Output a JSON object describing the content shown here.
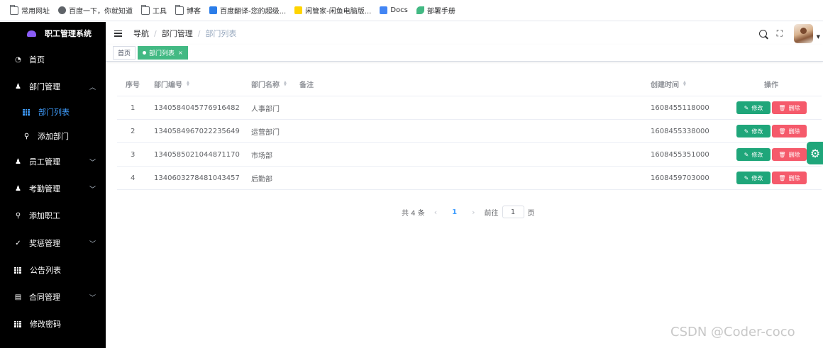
{
  "bookmarks": [
    {
      "label": "常用网址",
      "icon": "folder-icon"
    },
    {
      "label": "百度一下，你就知道",
      "icon": "globe-icon"
    },
    {
      "label": "工具",
      "icon": "folder-icon"
    },
    {
      "label": "博客",
      "icon": "folder-icon"
    },
    {
      "label": "百度翻译-您的超级...",
      "icon": "translate-icon"
    },
    {
      "label": "闲管家-闲鱼电脑版...",
      "icon": "xianyu-icon"
    },
    {
      "label": "Docs",
      "icon": "docs-icon"
    },
    {
      "label": "部署手册",
      "icon": "leaf-icon"
    }
  ],
  "app": {
    "title": "职工管理系统"
  },
  "sidebar": {
    "items": [
      {
        "label": "首页",
        "icon": "dashboard-icon"
      },
      {
        "label": "部门管理",
        "icon": "user-group-icon",
        "expanded": true
      },
      {
        "label": "部门列表",
        "icon": "table-icon",
        "active": true
      },
      {
        "label": "添加部门",
        "icon": "tree-icon"
      },
      {
        "label": "员工管理",
        "icon": "user-icon"
      },
      {
        "label": "考勤管理",
        "icon": "user-icon"
      },
      {
        "label": "添加职工",
        "icon": "tree-icon"
      },
      {
        "label": "奖惩管理",
        "icon": "check-icon"
      },
      {
        "label": "公告列表",
        "icon": "table-icon"
      },
      {
        "label": "合同管理",
        "icon": "document-icon"
      },
      {
        "label": "修改密码",
        "icon": "table-icon"
      }
    ]
  },
  "header": {
    "breadcrumb": [
      "导航",
      "部门管理",
      "部门列表"
    ]
  },
  "tags": [
    {
      "label": "首页",
      "active": false
    },
    {
      "label": "部门列表",
      "active": true,
      "close": "×"
    }
  ],
  "table": {
    "columns": [
      "序号",
      "部门编号",
      "部门名称",
      "备注",
      "创建时间",
      "操作"
    ],
    "rows": [
      {
        "index": "1",
        "id": "1340584045776916482",
        "name": "人事部门",
        "remark": "",
        "created": "1608455118000"
      },
      {
        "index": "2",
        "id": "1340584967022235649",
        "name": "运营部门",
        "remark": "",
        "created": "1608455338000"
      },
      {
        "index": "3",
        "id": "1340585021044871170",
        "name": "市场部",
        "remark": "",
        "created": "1608455351000"
      },
      {
        "index": "4",
        "id": "1340603278481043457",
        "name": "后勤部",
        "remark": "",
        "created": "1608459703000"
      }
    ],
    "edit_label": "修改",
    "delete_label": "删除"
  },
  "pagination": {
    "total": "共 4 条",
    "current": "1",
    "goto_prefix": "前往",
    "goto_value": "1",
    "goto_suffix": "页"
  },
  "watermark": "CSDN @Coder-coco",
  "colors": {
    "primary": "#409eff",
    "edit": "#1fa67a",
    "delete": "#f55a6b",
    "tag_active": "#42b983",
    "sidebar": "#000000"
  }
}
